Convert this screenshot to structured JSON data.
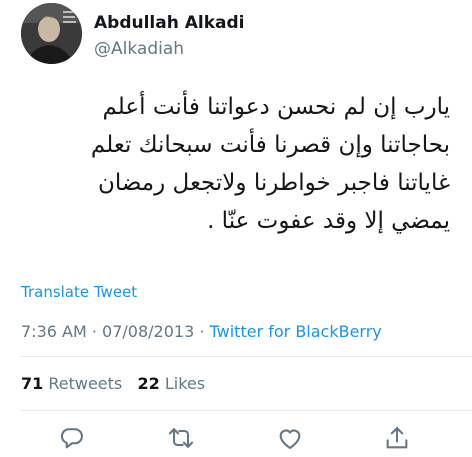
{
  "user": {
    "display_name": "Abdullah Alkadi",
    "handle": "@Alkadiah"
  },
  "tweet": {
    "lines": [
      "يارب إن لم نحسن دعواتنا فأنت أعلم",
      "بحاجاتنا وإن قصرنا فأنت سبحانك تعلم",
      "غاياتنا فاجبر خواطرنا ولاتجعل رمضان",
      "يمضي إلا وقد عفوت عنّا ."
    ]
  },
  "translate_label": "Translate Tweet",
  "meta": {
    "time": "7:36 AM",
    "separator1": " · ",
    "date": "07/08/2013",
    "separator2": " · ",
    "source": "Twitter for BlackBerry"
  },
  "stats": {
    "retweets_count": "71",
    "retweets_label": "Retweets",
    "likes_count": "22",
    "likes_label": "Likes"
  },
  "actions": {
    "icons": [
      "reply-icon",
      "retweet-icon",
      "like-icon",
      "share-icon"
    ],
    "icon_color": "#657786"
  },
  "colors": {
    "link": "#1b95e0",
    "secondary": "#657786",
    "text": "#14171a",
    "divider": "#e6ecf0"
  }
}
